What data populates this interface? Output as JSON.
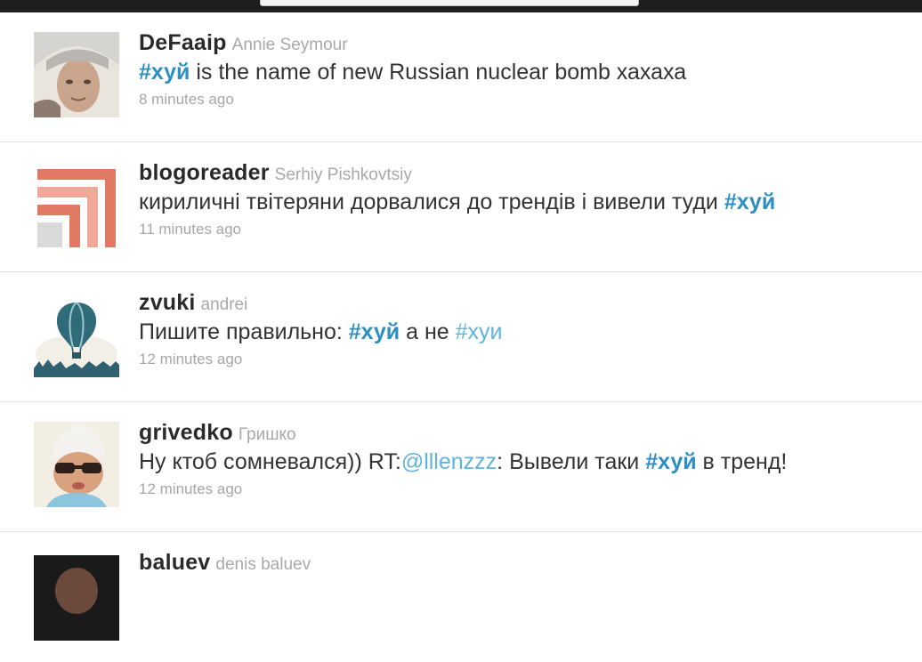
{
  "tweets": [
    {
      "screen_name": "DeFaaip",
      "full_name": "Annie Seymour",
      "text_parts": [
        "#хуй",
        " is the name of new Russian nuclear bomb хахаха"
      ],
      "timestamp": "8 minutes ago"
    },
    {
      "screen_name": "blogoreader",
      "full_name": "Serhiy Pishkovtsiy",
      "text_parts": [
        "кириличні твітеряни дорвалися до трендів і вивели туди ",
        "#хуй"
      ],
      "timestamp": "11 minutes ago"
    },
    {
      "screen_name": "zvuki",
      "full_name": "andrei",
      "text_parts": [
        "Пишите правильно: ",
        "#хуй",
        " а не ",
        "#хуи"
      ],
      "timestamp": "12 minutes ago"
    },
    {
      "screen_name": "grivedko",
      "full_name": "Гришко",
      "text_parts": [
        "Ну ктоб сомневался)) RT:",
        "@lllenzzz",
        ": Вывели таки ",
        "#хуй",
        " в тренд!"
      ],
      "timestamp": "12 minutes ago"
    },
    {
      "screen_name": "baluev",
      "full_name": "denis baluev"
    }
  ],
  "colors": {
    "hashtag": "#2b8fc4",
    "link": "#5fb3de",
    "timestamp": "#a6a6a6",
    "topbar": "#1e1e1e"
  }
}
